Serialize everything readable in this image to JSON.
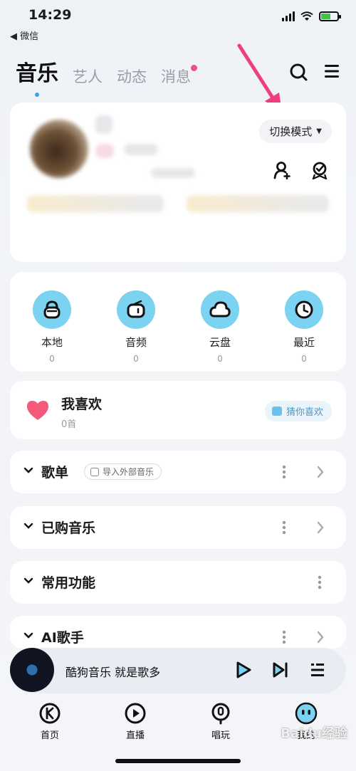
{
  "status": {
    "time": "14:29",
    "back_label": "◀ 微信"
  },
  "tabs": [
    {
      "label": "音乐",
      "active": true
    },
    {
      "label": "艺人",
      "active": false
    },
    {
      "label": "动态",
      "active": false
    },
    {
      "label": "消息",
      "active": false,
      "badge": true
    }
  ],
  "profile": {
    "mode_button": "切换模式"
  },
  "quick": [
    {
      "label": "本地",
      "count": "0",
      "icon": "local-icon"
    },
    {
      "label": "音频",
      "count": "0",
      "icon": "radio-icon"
    },
    {
      "label": "云盘",
      "count": "0",
      "icon": "cloud-icon"
    },
    {
      "label": "最近",
      "count": "0",
      "icon": "clock-icon"
    }
  ],
  "favorites": {
    "title": "我喜欢",
    "count": "0首",
    "guess_button": "猜你喜欢"
  },
  "sections": [
    {
      "title": "歌单",
      "tag": "导入外部音乐"
    },
    {
      "title": "已购音乐"
    },
    {
      "title": "常用功能"
    },
    {
      "title": "AI歌手"
    }
  ],
  "player": {
    "text": "酷狗音乐   就是歌多"
  },
  "nav": [
    {
      "label": "首页",
      "icon": "kugou-home-icon"
    },
    {
      "label": "直播",
      "icon": "live-play-icon"
    },
    {
      "label": "唱玩",
      "icon": "mic-icon"
    },
    {
      "label": "我的",
      "icon": "my-face-icon"
    }
  ],
  "watermark": "Baidu经验",
  "colors": {
    "accent": "#3aa0ea",
    "icon_bg": "#7cd2f1",
    "badge": "#f0507a",
    "arrow": "#ee3f7a"
  }
}
